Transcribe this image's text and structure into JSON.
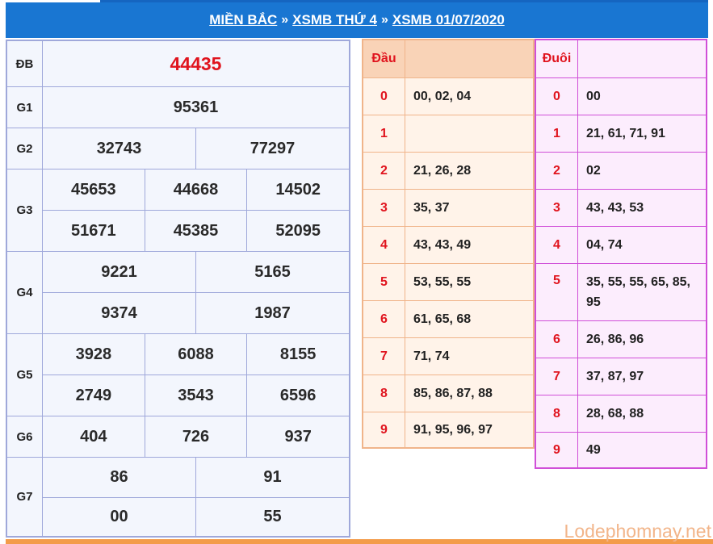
{
  "header": {
    "crumb1": "MIỀN BẮC",
    "crumb2": "XSMB THỨ 4",
    "crumb3": "XSMB 01/07/2020",
    "separator": "»"
  },
  "prizes": {
    "db": {
      "label": "ĐB",
      "values": [
        "44435"
      ]
    },
    "g1": {
      "label": "G1",
      "values": [
        "95361"
      ]
    },
    "g2": {
      "label": "G2",
      "values": [
        "32743",
        "77297"
      ]
    },
    "g3": {
      "label": "G3",
      "values": [
        "45653",
        "44668",
        "14502",
        "51671",
        "45385",
        "52095"
      ]
    },
    "g4": {
      "label": "G4",
      "values": [
        "9221",
        "5165",
        "9374",
        "1987"
      ]
    },
    "g5": {
      "label": "G5",
      "values": [
        "3928",
        "6088",
        "8155",
        "2749",
        "3543",
        "6596"
      ]
    },
    "g6": {
      "label": "G6",
      "values": [
        "404",
        "726",
        "937"
      ]
    },
    "g7": {
      "label": "G7",
      "values": [
        "86",
        "91",
        "00",
        "55"
      ]
    }
  },
  "dau": {
    "header": "Đầu",
    "rows": [
      {
        "key": "0",
        "value": "00, 02, 04"
      },
      {
        "key": "1",
        "value": ""
      },
      {
        "key": "2",
        "value": "21, 26, 28"
      },
      {
        "key": "3",
        "value": "35, 37"
      },
      {
        "key": "4",
        "value": "43, 43, 49"
      },
      {
        "key": "5",
        "value": "53, 55, 55"
      },
      {
        "key": "6",
        "value": "61, 65, 68"
      },
      {
        "key": "7",
        "value": "71, 74"
      },
      {
        "key": "8",
        "value": "85, 86, 87, 88"
      },
      {
        "key": "9",
        "value": "91, 95, 96, 97"
      }
    ]
  },
  "duoi": {
    "header": "Đuôi",
    "rows": [
      {
        "key": "0",
        "value": "00"
      },
      {
        "key": "1",
        "value": "21, 61, 71, 91"
      },
      {
        "key": "2",
        "value": "02"
      },
      {
        "key": "3",
        "value": "43, 43, 53"
      },
      {
        "key": "4",
        "value": "04, 74"
      },
      {
        "key": "5",
        "value": "35, 55, 55, 65, 85, 95"
      },
      {
        "key": "6",
        "value": "26, 86, 96"
      },
      {
        "key": "7",
        "value": "37, 87, 97"
      },
      {
        "key": "8",
        "value": "28, 68, 88"
      },
      {
        "key": "9",
        "value": "49"
      }
    ]
  },
  "watermark": "Lodephomnay.net",
  "colors": {
    "header_bg": "#1976d2",
    "special": "#e0141e",
    "dau_border": "#f0b48a",
    "duoi_border": "#d04fd8"
  }
}
